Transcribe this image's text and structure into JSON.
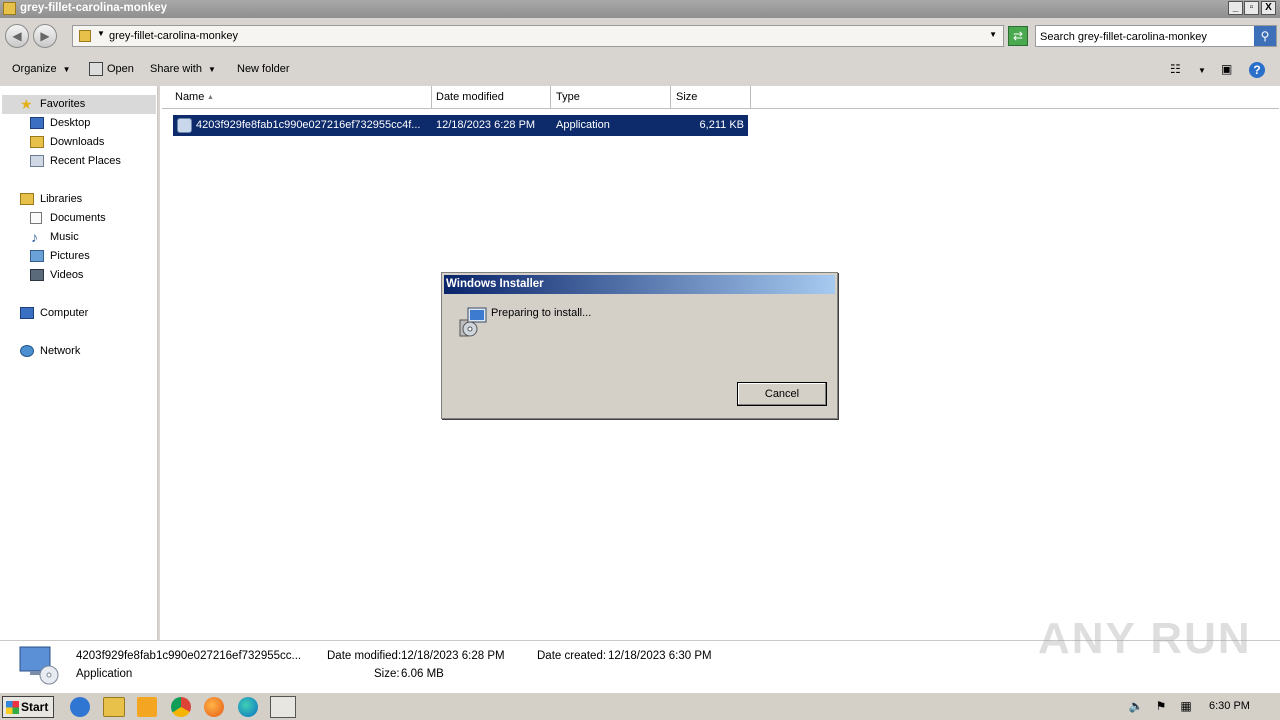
{
  "window": {
    "title": "grey-fillet-carolina-monkey",
    "minimize": "_",
    "maximize": "▫",
    "close": "X"
  },
  "address": {
    "path": "grey-fillet-carolina-monkey",
    "search_placeholder": "Search grey-fillet-carolina-monkey"
  },
  "toolbar": {
    "organize": "Organize",
    "open": "Open",
    "share_with": "Share with",
    "new_folder": "New folder"
  },
  "nav": {
    "favorites": "Favorites",
    "desktop": "Desktop",
    "downloads": "Downloads",
    "recent_places": "Recent Places",
    "libraries": "Libraries",
    "documents": "Documents",
    "music": "Music",
    "pictures": "Pictures",
    "videos": "Videos",
    "computer": "Computer",
    "network": "Network"
  },
  "columns": {
    "name": "Name",
    "date_modified": "Date modified",
    "type": "Type",
    "size": "Size"
  },
  "files": [
    {
      "name": "4203f929fe8fab1c990e027216ef732955cc4f...",
      "date_modified": "12/18/2023 6:28 PM",
      "type": "Application",
      "size": "6,211 KB"
    }
  ],
  "details": {
    "name": "4203f929fe8fab1c990e027216ef732955cc...",
    "type": "Application",
    "date_modified_label": "Date modified:",
    "date_modified": "12/18/2023 6:28 PM",
    "date_created_label": "Date created:",
    "date_created": "12/18/2023 6:30 PM",
    "size_label": "Size:",
    "size": "6.06 MB"
  },
  "dialog": {
    "title": "Windows Installer",
    "message": "Preparing to install...",
    "cancel": "Cancel"
  },
  "taskbar": {
    "start": "Start",
    "clock": "6:30 PM"
  },
  "watermark": "ANY RUN",
  "colors": {
    "selection": "#0d2a6b",
    "dialog_title_start": "#0a246a",
    "dialog_title_end": "#a6caf0",
    "chrome": "#d8d5d0"
  }
}
